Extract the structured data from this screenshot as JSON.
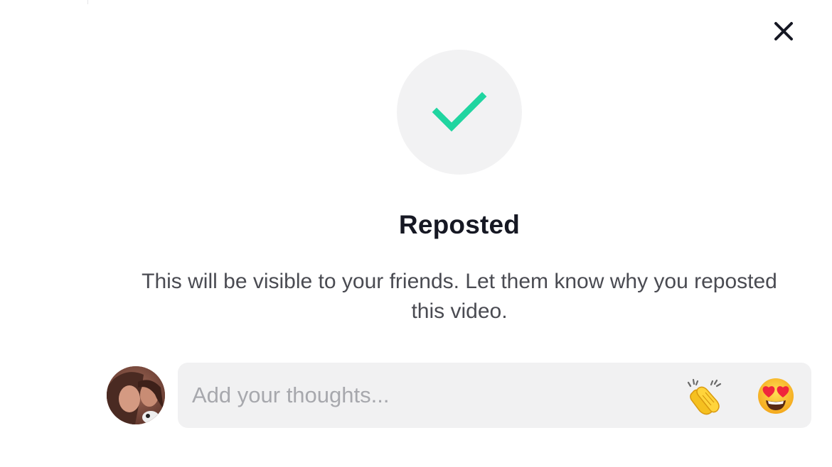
{
  "dialog": {
    "title": "Reposted",
    "message": "This will be visible to your friends. Let them know why you reposted this video."
  },
  "comment": {
    "placeholder": "Add your thoughts...",
    "value": ""
  },
  "icons": {
    "close": "close-icon",
    "check": "checkmark-icon",
    "avatar": "user-avatar",
    "clap": "clapping-hands-emoji",
    "heart_eyes": "heart-eyes-emoji"
  },
  "colors": {
    "check": "#20d5a0",
    "title": "#161823",
    "message": "#4a4b52",
    "input_bg": "#f1f1f2",
    "circle_bg": "#f2f2f3"
  }
}
